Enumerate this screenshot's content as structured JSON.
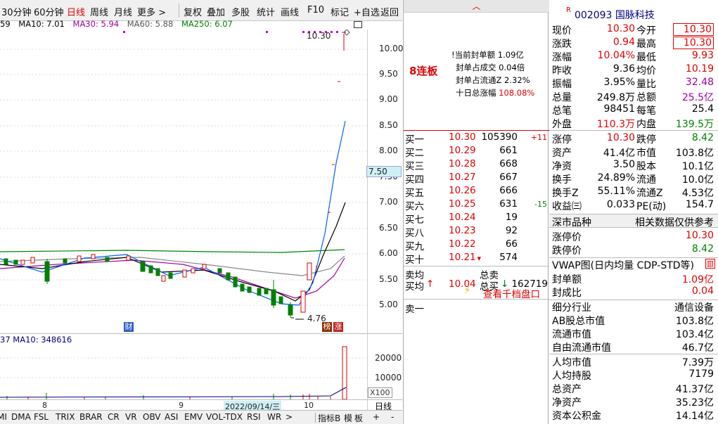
{
  "toolbar": {
    "items": [
      "30分钟",
      "60分钟",
      "日线",
      "周线",
      "月线",
      "更多",
      "复权",
      "叠加",
      "多股",
      "统计",
      "画线",
      "F10",
      "标记",
      "+自选",
      "返回"
    ]
  },
  "ma": {
    "lead": "59",
    "ma10": "MA10: 7.01",
    "ma30": "MA30: 5.94",
    "ma60": "MA60: 5.88",
    "ma250": "MA250: 6.07"
  },
  "axis": {
    "labels": [
      "10.00",
      "9.50",
      "9.00",
      "8.50",
      "8.00",
      "7.50",
      "7.00",
      "6.50",
      "6.00",
      "5.50",
      "5.00"
    ],
    "current": "7.50"
  },
  "chart": {
    "high_label": "10.30",
    "low_label": "4.76",
    "fin_marker": "财",
    "bang_marker": "榜",
    "zhang_marker": "涨"
  },
  "volume": {
    "legend": "37  MA10: 348616",
    "labels": [
      "20000",
      "10000"
    ],
    "unit": "X100"
  },
  "dates": {
    "d1": "8",
    "d2": "9",
    "d3": "2022/09/14/三",
    "d4": "10",
    "period": "日线"
  },
  "indicators": {
    "items": [
      "MI",
      "DMA",
      "FSL",
      "TRIX",
      "BRAR",
      "CR",
      "VR",
      "OBV",
      "ASI",
      "EMV",
      "VOL-TDX",
      "RSI",
      "WR"
    ],
    "more": ">",
    "right": [
      "指标B",
      "模",
      "板",
      "+",
      "-"
    ]
  },
  "seal": {
    "board": "8连板",
    "l1": "!当前封单额",
    "v1": "1.09亿",
    "l2": "封单占成交",
    "v2": "0.04倍",
    "l3": "封单占流通Z",
    "v3": "2.32%",
    "l4": "十日总涨幅",
    "v4": "108.08%"
  },
  "orderbook": {
    "bids": [
      {
        "name": "买一",
        "price": "10.30",
        "vol": "105390",
        "chg": "+11"
      },
      {
        "name": "买二",
        "price": "10.29",
        "vol": "661",
        "chg": ""
      },
      {
        "name": "买三",
        "price": "10.28",
        "vol": "668",
        "chg": ""
      },
      {
        "name": "买四",
        "price": "10.27",
        "vol": "667",
        "chg": ""
      },
      {
        "name": "买五",
        "price": "10.26",
        "vol": "666",
        "chg": ""
      },
      {
        "name": "买六",
        "price": "10.25",
        "vol": "631",
        "chg": "-15"
      },
      {
        "name": "买七",
        "price": "10.24",
        "vol": "19",
        "chg": ""
      },
      {
        "name": "买八",
        "price": "10.23",
        "vol": "92",
        "chg": ""
      },
      {
        "name": "买九",
        "price": "10.22",
        "vol": "66",
        "chg": ""
      },
      {
        "name": "买十",
        "price": "10.21",
        "vol": "574",
        "chg": ""
      }
    ],
    "sell_avg_label": "卖均",
    "total_sell_label": "总卖",
    "buy_avg_label": "买均",
    "buy_avg": "10.04",
    "total_buy_label": "总买",
    "total_buy": "162719",
    "thousand": "查看千档盘口",
    "ask1": "卖一"
  },
  "quote": {
    "flag": "R",
    "code": "002093",
    "name": "国脉科技",
    "rows": [
      {
        "a": "现价",
        "b": "10.30",
        "c": "今开",
        "d": "10.30"
      },
      {
        "a": "涨跌",
        "b": "0.94",
        "c": "最高",
        "d": "10.30"
      },
      {
        "a": "涨幅",
        "b": "10.04%",
        "c": "最低",
        "d": "9.93"
      },
      {
        "a": "昨收",
        "b": "9.36",
        "c": "均价",
        "d": "10.19"
      },
      {
        "a": "振幅",
        "b": "3.95%",
        "c": "量比",
        "d": "32.48"
      },
      {
        "a": "总量",
        "b": "249.8万",
        "c": "总额",
        "d": "25.5亿"
      },
      {
        "a": "总笔",
        "b": "98451",
        "c": "每笔",
        "d": "25.4"
      },
      {
        "a": "外盘",
        "b": "110.3万",
        "c": "内盘",
        "d": "139.5万"
      },
      {
        "a": "涨停",
        "b": "10.30",
        "c": "跌停",
        "d": "8.42"
      },
      {
        "a": "资产",
        "b": "41.4亿",
        "c": "市值",
        "d": "103.8亿"
      },
      {
        "a": "净资",
        "b": "3.50",
        "c": "股本",
        "d": "10.1亿"
      },
      {
        "a": "换手",
        "b": "24.89%",
        "c": "流通",
        "d": "10.0亿"
      },
      {
        "a": "换手Z",
        "b": "55.11%",
        "c": "流通Z",
        "d": "4.53亿"
      },
      {
        "a": "收益㈢",
        "b": "0.033",
        "c": "PE(动)",
        "d": "154.7"
      }
    ],
    "sec1_title": "深市品种",
    "sec1_note": "相关数据仅供参考",
    "limit_up_label": "涨停价",
    "limit_up": "10.30",
    "limit_down_label": "跌停价",
    "limit_down": "8.42",
    "vwap": "VWAP图(日内均量 CDP-STD等)",
    "seal_amt_label": "封单额",
    "seal_amt": "1.09亿",
    "seal_ratio_label": "封成比",
    "seal_ratio": "0.04",
    "detail": [
      {
        "a": "细分行业",
        "d": "通信设备"
      },
      {
        "a": "AB股总市值",
        "d": "103.8亿"
      },
      {
        "a": "流通市值",
        "d": "103.4亿"
      },
      {
        "a": "自由流通市值",
        "d": "46.7亿"
      }
    ],
    "detail2": [
      {
        "a": "人均市值",
        "d": "7.39万"
      },
      {
        "a": "人均持股",
        "d": "7179"
      },
      {
        "a": "总资产",
        "d": "41.37亿"
      },
      {
        "a": "净资产",
        "d": "35.23亿"
      },
      {
        "a": "资本公积金",
        "d": "14.14亿"
      }
    ]
  }
}
